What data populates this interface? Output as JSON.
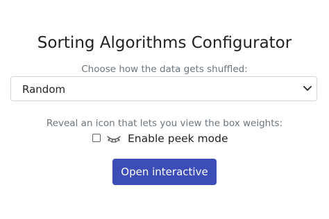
{
  "page": {
    "title": "Sorting Algorithms Configurator"
  },
  "shuffle": {
    "label": "Choose how the data gets shuffled:",
    "selected": "Random"
  },
  "peek": {
    "hint": "Reveal an icon that lets you view the box weights:",
    "checked": false,
    "icon": "eye-closed-icon",
    "label": "Enable peek mode"
  },
  "actions": {
    "open_label": "Open interactive",
    "button_color": "#3d4db7"
  }
}
